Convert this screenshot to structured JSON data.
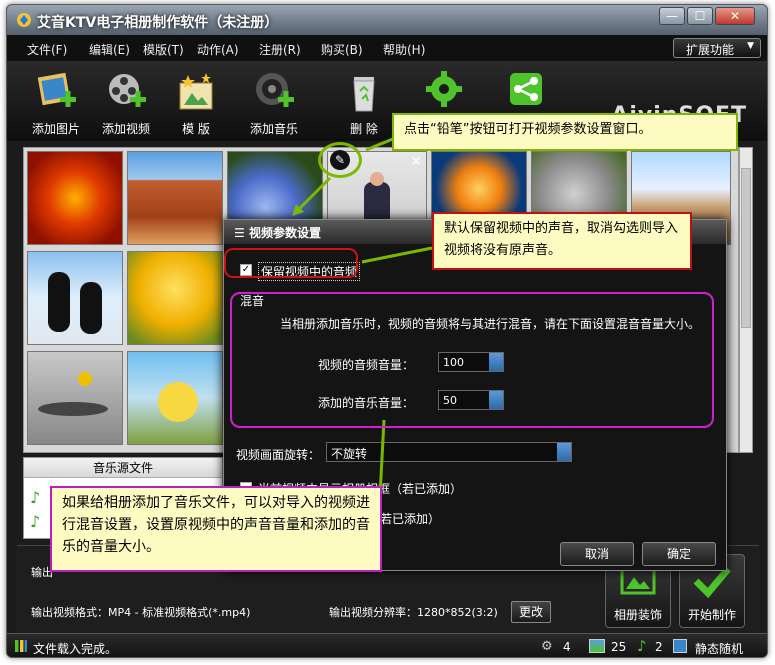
{
  "window": {
    "title": "艾音KTV电子相册制作软件（未注册）",
    "min": "—",
    "max": "☐",
    "close": "✕"
  },
  "menu": {
    "items": [
      "文件(F)",
      "编辑(E)",
      "模版(T)",
      "动作(A)",
      "注册(R)",
      "购买(B)",
      "帮助(H)"
    ],
    "extend": "扩展功能"
  },
  "toolbar": {
    "buttons": [
      "添加图片",
      "添加视频",
      "模 版",
      "添加音乐",
      "删 除"
    ]
  },
  "brand": "AiyinSOFT",
  "music_panel": {
    "header": "音乐源文件"
  },
  "bottom": {
    "output_label": "输出",
    "format": "输出视频格式：MP4 - 标准视频格式(*.mp4)",
    "resolution": "输出视频分辨率：1280*852(3:2)",
    "change_btn": "更改",
    "decorate_btn": "相册装饰",
    "start_btn": "开始制作"
  },
  "status": {
    "message": "文件载入完成。",
    "photos": "4",
    "images": "25",
    "music": "2",
    "mode": "静态随机"
  },
  "dialog": {
    "title": "视频参数设置",
    "keep_audio": "保留视频中的音频",
    "mix_label": "混音",
    "mix_desc": "当相册添加音乐时，视频的音频将与其进行混音，请在下面设置混音音量大小。",
    "video_vol_label": "视频的音频音量：",
    "video_vol": "100",
    "music_vol_label": "添加的音乐音量：",
    "music_vol": "50",
    "rotate_label": "视频画面旋转：",
    "rotate_value": "不旋转",
    "show_frame": "当前视频中显示相册相框（若已添加）",
    "show_decor": "（若已添加）",
    "cancel": "取消",
    "ok": "确定"
  },
  "callouts": {
    "pencil": "点击“铅笔”按钮可打开视频参数设置窗口。",
    "keep": "默认保留视频中的声音，取消勾选则导入视频将没有原声音。",
    "mix": "如果给相册添加了音乐文件，可以对导入的视频进行混音设置，设置原视频中的声音音量和添加的音乐的音量大小。"
  }
}
